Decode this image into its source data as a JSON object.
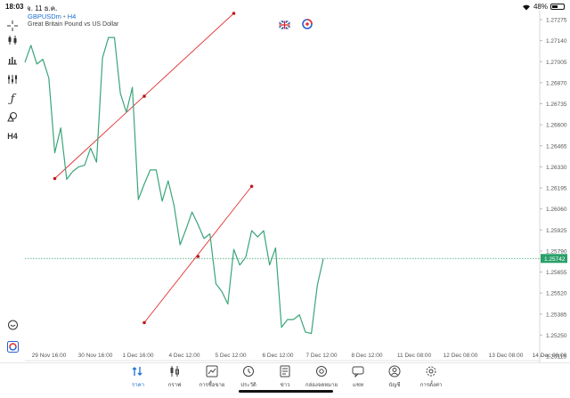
{
  "status_bar": {
    "time": "18:03",
    "date": "จ. 11 ธ.ค.",
    "battery": "48%",
    "battery_level": 0.48
  },
  "header": {
    "symbol": "GBPUSDm",
    "separator": "•",
    "timeframe": "H4",
    "description": "Great Britain Pound vs US Dollar"
  },
  "toolbar": {
    "timeframe_label": "H4",
    "icons": [
      "crosshair-icon",
      "candlestick-icon",
      "chart-type-icon",
      "indicators-icon",
      "function-icon",
      "shapes-icon",
      "timeframe-icon",
      "chat-icon",
      "brand-icon"
    ]
  },
  "colors": {
    "line": "#3aa57a",
    "trendline": "#e03030",
    "current_price_line": "#2aa06a",
    "accent": "#1a6fd1"
  },
  "chart_data": {
    "type": "line",
    "symbol": "GBPUSDm",
    "price_axis": [
      "1.27275",
      "1.27140",
      "1.27005",
      "1.26870",
      "1.26735",
      "1.26600",
      "1.26465",
      "1.26330",
      "1.26195",
      "1.26060",
      "1.25925",
      "1.25790",
      "1.25655",
      "1.25520",
      "1.25385",
      "1.25250",
      "1.25115"
    ],
    "time_axis": [
      "29 Nov 16:00",
      "30 Nov 16:00",
      "1 Dec 16:00",
      "4 Dec 12:00",
      "5 Dec 12:00",
      "6 Dec 12:00",
      "7 Dec 12:00",
      "8 Dec 12:00",
      "11 Dec 08:00",
      "12 Dec 08:00",
      "13 Dec 08:00",
      "14 Dec 08:00"
    ],
    "current_price": "1.25742",
    "current_price_value": 1.25742,
    "ylim": [
      1.2501,
      1.274
    ],
    "series": [
      {
        "values": [
          1.27,
          1.2711,
          1.2699,
          1.2702,
          1.269,
          1.2642,
          1.2658,
          1.2625,
          1.263,
          1.2633,
          1.2634,
          1.2645,
          1.2636,
          1.2703,
          1.2716,
          1.2716,
          1.268,
          1.2668,
          1.2684,
          1.2612,
          1.2622,
          1.2631,
          1.2631,
          1.2611,
          1.2624,
          1.2608,
          1.2583,
          1.2593,
          1.2604,
          1.2596,
          1.2587,
          1.259,
          1.2558,
          1.2553,
          1.2545,
          1.258,
          1.257,
          1.2575,
          1.2592,
          1.2588,
          1.2592,
          1.257,
          1.2581,
          1.253,
          1.2535,
          1.2535,
          1.2538,
          1.2527,
          1.2526,
          1.2557,
          1.2574
        ]
      }
    ],
    "trendlines": [
      {
        "start": [
          5,
          1.26255
        ],
        "mid": [
          20,
          1.26783
        ],
        "end": [
          35,
          1.27315
        ]
      },
      {
        "start": [
          20,
          1.2533
        ],
        "mid": [
          29,
          1.25755
        ],
        "end": [
          38,
          1.26205
        ]
      }
    ]
  },
  "bottom_nav": [
    {
      "label": "ราคา",
      "icon": "quotes-icon",
      "active": true
    },
    {
      "label": "กราฟ",
      "icon": "chart-icon",
      "active": false
    },
    {
      "label": "การซื้อขาย",
      "icon": "trade-icon",
      "active": false
    },
    {
      "label": "ประวัติ",
      "icon": "history-icon",
      "active": false
    },
    {
      "label": "ข่าว",
      "icon": "news-icon",
      "active": false
    },
    {
      "label": "กล่องจดหมาย",
      "icon": "mailbox-icon",
      "active": false
    },
    {
      "label": "แชท",
      "icon": "chat-icon",
      "active": false
    },
    {
      "label": "บัญชี",
      "icon": "account-icon",
      "active": false
    },
    {
      "label": "การตั้งค่า",
      "icon": "settings-icon",
      "active": false
    }
  ]
}
